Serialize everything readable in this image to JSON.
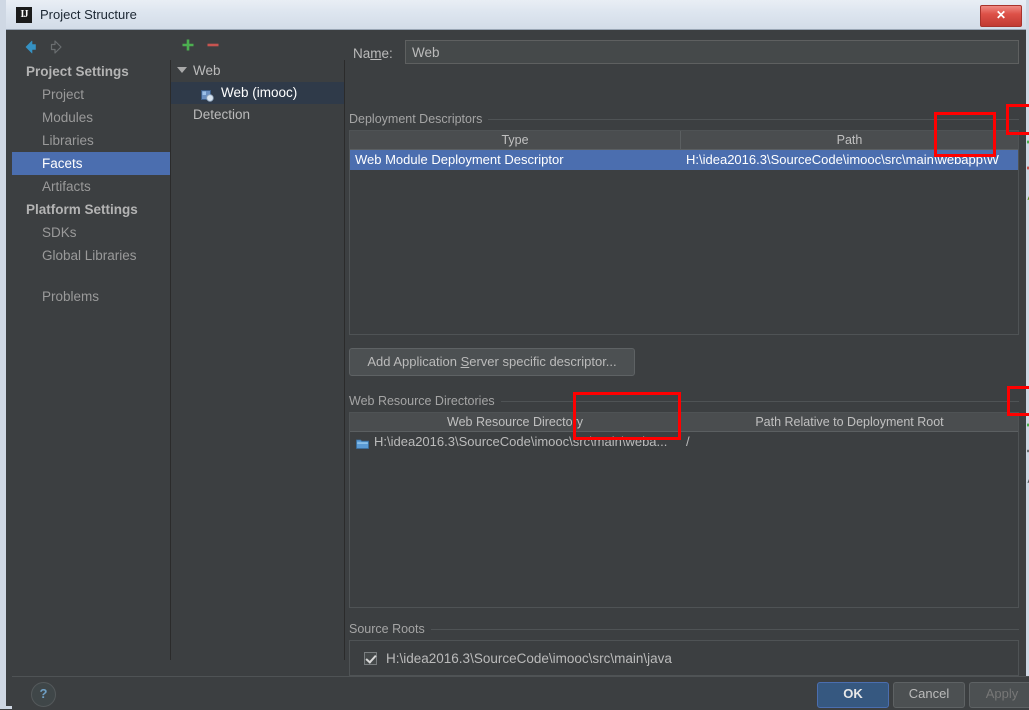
{
  "window": {
    "title": "Project Structure",
    "app_icon": "IJ",
    "close_label": "✕"
  },
  "nav": {
    "back_icon": "arrow-left-icon",
    "forward_icon": "arrow-right-icon"
  },
  "sidebar": {
    "items": [
      {
        "label": "Project Settings",
        "type": "header",
        "selected": false
      },
      {
        "label": "Project",
        "type": "child",
        "selected": false
      },
      {
        "label": "Modules",
        "type": "child",
        "selected": false
      },
      {
        "label": "Libraries",
        "type": "child",
        "selected": false
      },
      {
        "label": "Facets",
        "type": "child",
        "selected": true
      },
      {
        "label": "Artifacts",
        "type": "child",
        "selected": false
      },
      {
        "label": "Platform Settings",
        "type": "header",
        "selected": false
      },
      {
        "label": "SDKs",
        "type": "child",
        "selected": false
      },
      {
        "label": "Global Libraries",
        "type": "child",
        "selected": false
      },
      {
        "label": "Problems",
        "type": "child",
        "selected": false
      }
    ]
  },
  "tree": {
    "toolbar": {
      "add_label": "+",
      "remove_label": "−"
    },
    "nodes": [
      {
        "label": "Web",
        "level": 1,
        "selected": false,
        "expanded": true
      },
      {
        "label": "Web (imooc)",
        "level": 2,
        "selected": true,
        "expanded": false
      },
      {
        "label": "Detection",
        "level": 1,
        "selected": false,
        "expanded": false
      }
    ]
  },
  "main": {
    "name": {
      "label": "Na",
      "label_accel": "m",
      "label_tail": "e:",
      "value": "Web",
      "placeholder": ""
    },
    "deployment_descriptors": {
      "title": "Deployment Descriptors",
      "columns": [
        "Type",
        "Path"
      ],
      "rows": [
        {
          "type": "Web Module Deployment Descriptor",
          "path": "H:\\idea2016.3\\SourceCode\\imooc\\src\\main\\webapp\\W",
          "selected": true
        }
      ],
      "tools": [
        "add-icon",
        "remove-icon",
        "edit-icon"
      ]
    },
    "add_descriptor_button": {
      "prefix": "Add Application ",
      "accel": "S",
      "suffix": "erver specific descriptor..."
    },
    "web_resource_directories": {
      "title": "Web Resource Directories",
      "columns": [
        "Web Resource Directory",
        "Path Relative to Deployment Root"
      ],
      "rows": [
        {
          "directory": "H:\\idea2016.3\\SourceCode\\imooc\\src\\main\\weba...",
          "relative_path": "/",
          "icon": "folder-icon"
        }
      ],
      "tools": [
        "add-icon",
        "remove-icon",
        "edit-icon",
        "help-icon"
      ]
    },
    "source_roots": {
      "title": "Source Roots",
      "rows": [
        {
          "path": "H:\\idea2016.3\\SourceCode\\imooc\\src\\main\\java",
          "checked": true
        }
      ]
    }
  },
  "footer": {
    "help_label": "?",
    "ok_label": "OK",
    "cancel_label": "Cancel",
    "apply_label": "Apply"
  },
  "colors": {
    "accent": "#4b6eaf",
    "annotation": "#ff0000",
    "background": "#3c3f41",
    "primary_button": "#365880"
  }
}
